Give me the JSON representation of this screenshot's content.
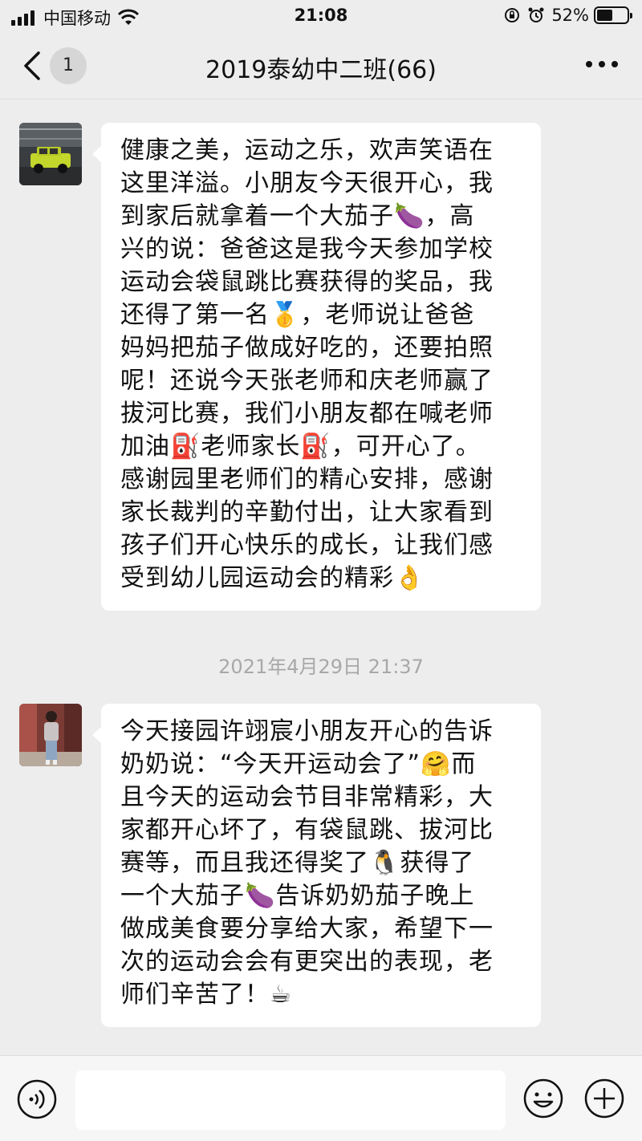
{
  "status_bar": {
    "carrier": "中国移动",
    "time": "21:08",
    "battery": "52%",
    "battery_level": 0.52
  },
  "nav": {
    "back_icon": "chevron-left-icon",
    "unread_count": "1",
    "title": "2019泰幼中二班(66)",
    "more_icon": "more-dots-icon"
  },
  "messages": [
    {
      "avatar": "green-suv-photo",
      "text": "健康之美，运动之乐，欢声笑语在\n这里洋溢。小朋友今天很开心，我\n到家后就拿着一个大茄子🍆，高\n兴的说：爸爸这是我今天参加学校\n运动会袋鼠跳比赛获得的奖品，我\n还得了第一名🥇，老师说让爸爸\n妈妈把茄子做成好吃的，还要拍照\n呢！还说今天张老师和庆老师赢了\n拔河比赛，我们小朋友都在喊老师\n加油⛽老师家长⛽，可开心了。\n感谢园里老师们的精心安排，感谢\n家长裁判的辛勤付出，让大家看到\n孩子们开心快乐的成长，让我们感\n受到幼儿园运动会的精彩👌"
    },
    {
      "avatar": "woman-photo",
      "text": "今天接园许翊宸小朋友开心的告诉\n奶奶说：“今天开运动会了”🤗而\n且今天的运动会节目非常精彩，大\n家都开心坏了，有袋鼠跳、拔河比\n赛等，而且我还得奖了🐧获得了\n一个大茄子🍆告诉奶奶茄子晚上\n做成美食要分享给大家，希望下一\n次的运动会会有更突出的表现，老\n师们辛苦了！☕"
    }
  ],
  "timestamp": "2021年4月29日 21:37",
  "input_bar": {
    "voice_icon": "voice-icon",
    "emoji_icon": "emoji-icon",
    "plus_icon": "plus-icon",
    "text_value": ""
  },
  "colors": {
    "background": "#ededed",
    "bubble": "#ffffff",
    "timestamp": "#a8a8a8"
  }
}
